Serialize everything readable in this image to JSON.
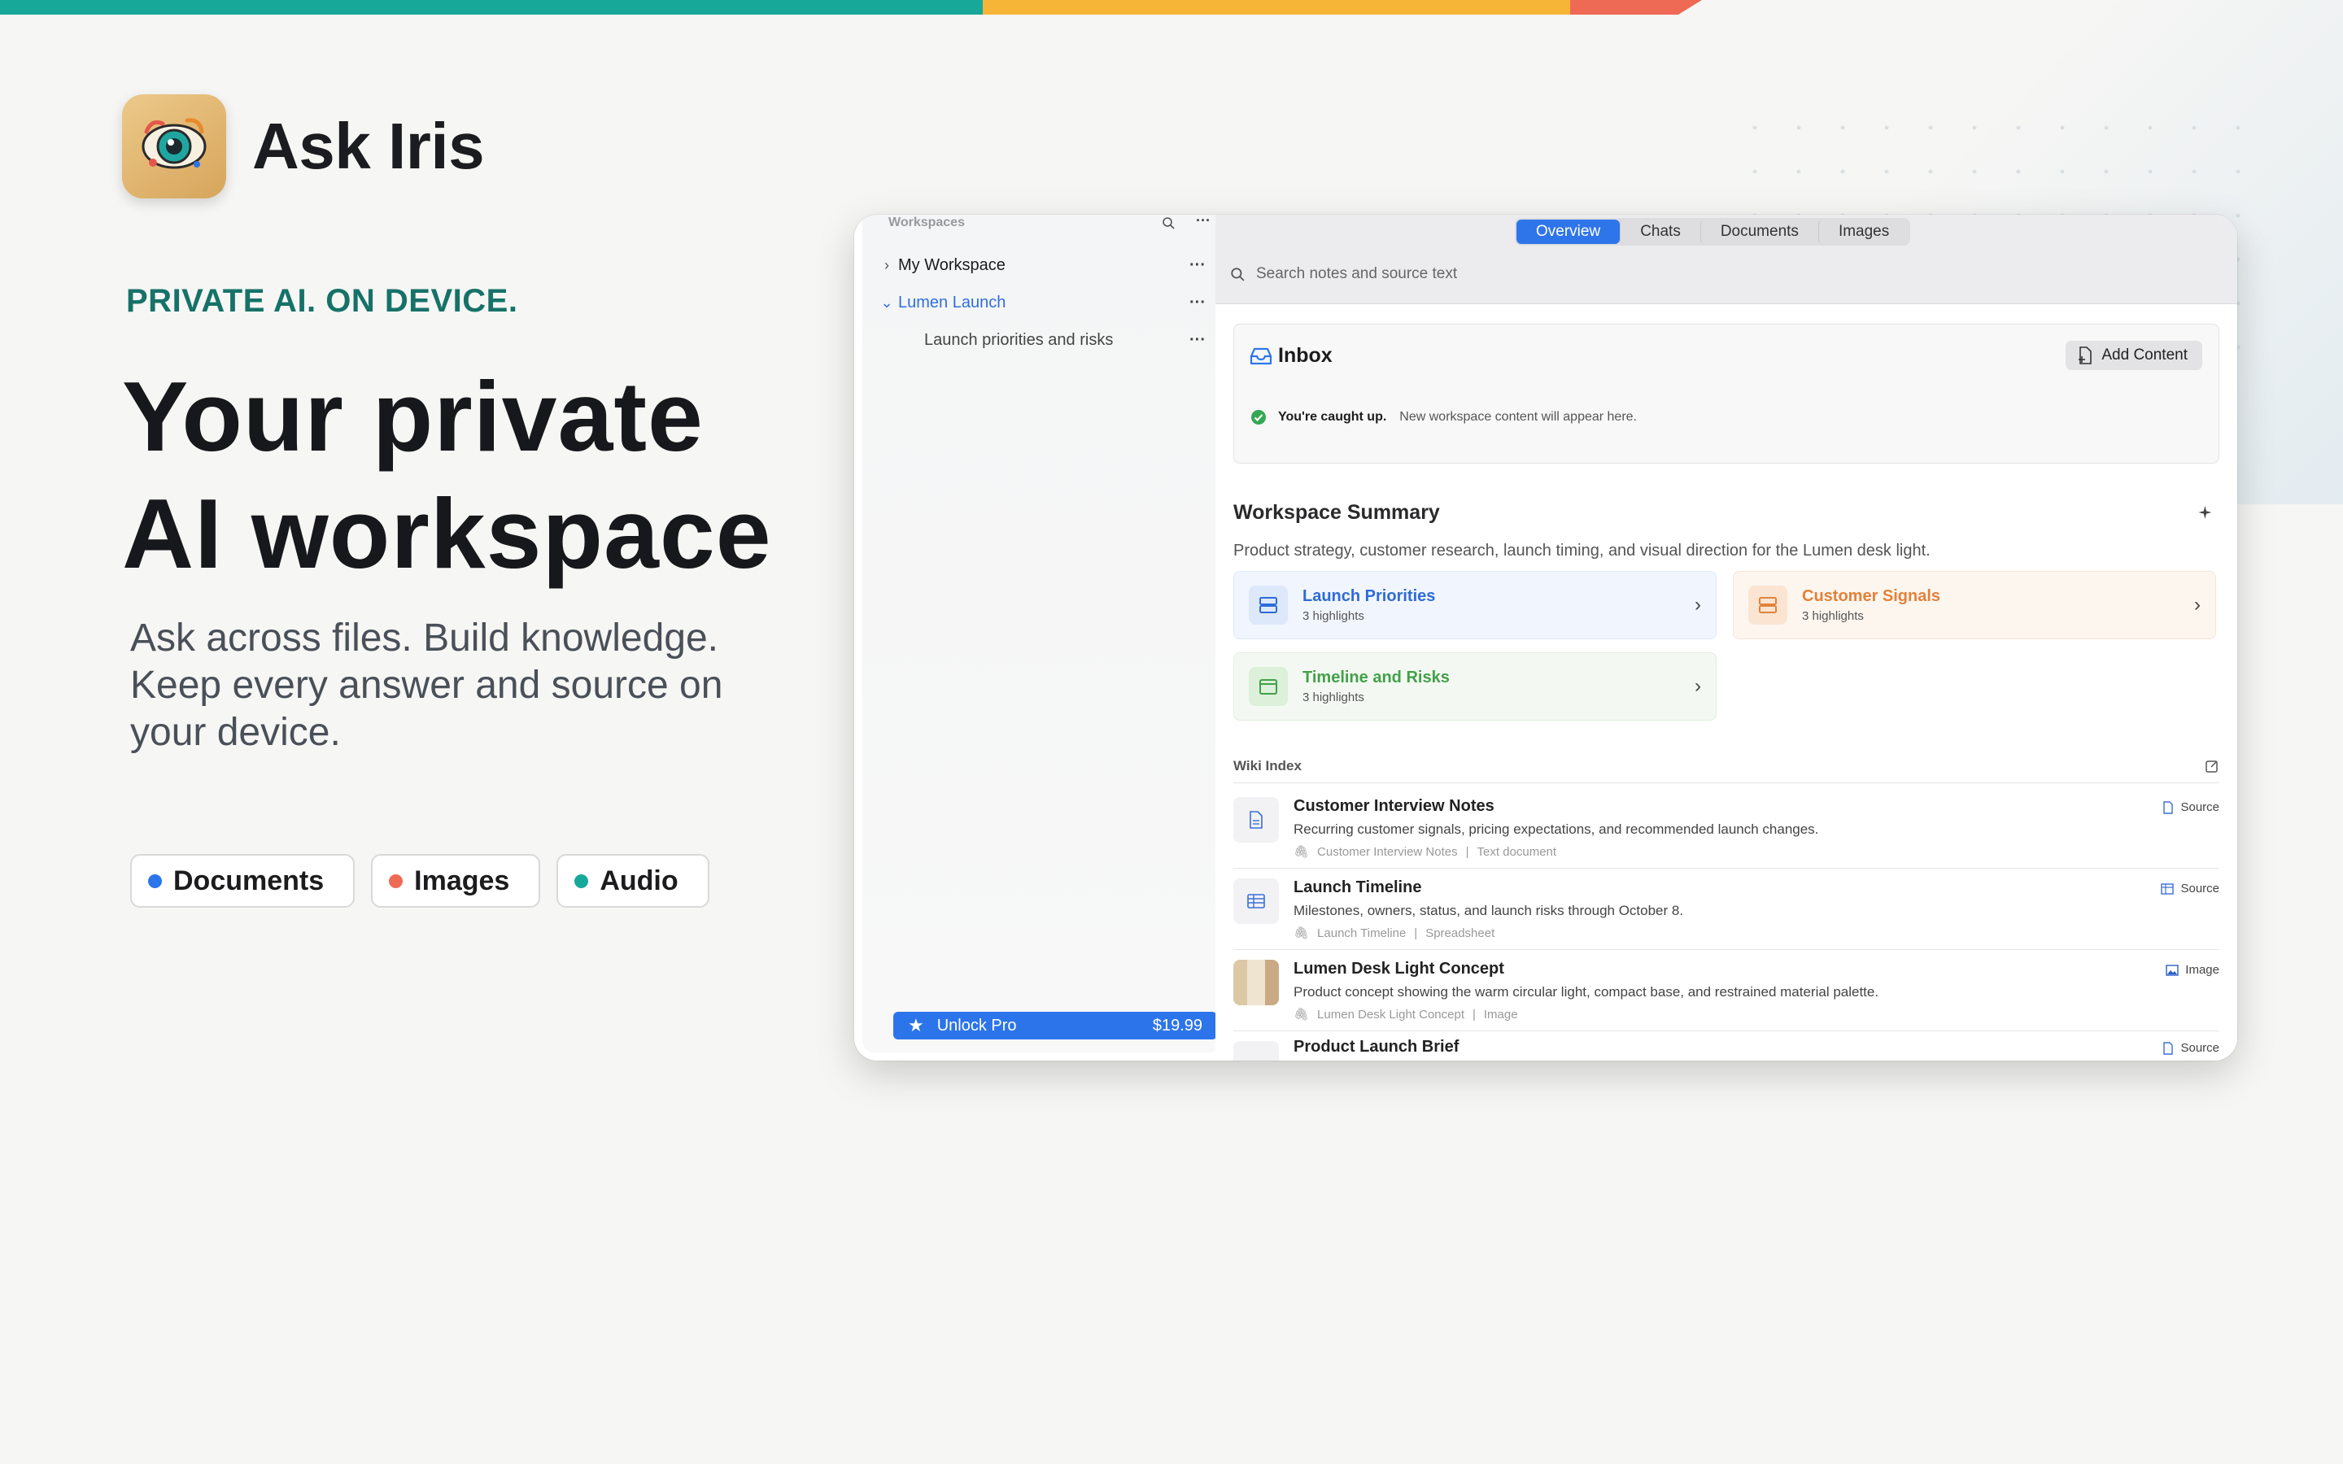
{
  "brand": {
    "name": "Ask Iris"
  },
  "hero": {
    "eyebrow": "PRIVATE AI. ON DEVICE.",
    "headline_line1": "Your private",
    "headline_line2": "AI workspace",
    "subcopy": "Ask across files. Build knowledge. Keep every answer and source on your device."
  },
  "chips": [
    {
      "label": "Documents",
      "color": "#2c74ea"
    },
    {
      "label": "Images",
      "color": "#ef6a55"
    },
    {
      "label": "Audio",
      "color": "#18a89a"
    }
  ],
  "sidebar": {
    "header": "Workspaces",
    "items": [
      {
        "label": "My Workspace"
      },
      {
        "label": "Lumen Launch"
      },
      {
        "label": "Launch priorities and risks"
      }
    ],
    "unlock": {
      "label": "Unlock Pro",
      "price": "$19.99"
    }
  },
  "toolbar": {
    "tabs": [
      "Overview",
      "Chats",
      "Documents",
      "Images"
    ],
    "search_placeholder": "Search notes and source text"
  },
  "inbox": {
    "title": "Inbox",
    "add_label": "Add Content",
    "status_bold": "You're caught up.",
    "status_msg": "New workspace content will appear here."
  },
  "summary": {
    "title": "Workspace Summary",
    "description": "Product strategy, customer research, launch timing, and visual direction for the Lumen desk light.",
    "cards": [
      {
        "title": "Launch Priorities",
        "sub": "3 highlights"
      },
      {
        "title": "Customer Signals",
        "sub": "3 highlights"
      },
      {
        "title": "Timeline and Risks",
        "sub": "3 highlights"
      }
    ]
  },
  "wiki": {
    "title": "Wiki Index",
    "rows": [
      {
        "title": "Customer Interview Notes",
        "desc": "Recurring customer signals, pricing expectations, and recommended launch changes.",
        "meta_name": "Customer Interview Notes",
        "meta_type": "Text document",
        "tag": "Source"
      },
      {
        "title": "Launch Timeline",
        "desc": "Milestones, owners, status, and launch risks through October 8.",
        "meta_name": "Launch Timeline",
        "meta_type": "Spreadsheet",
        "tag": "Source"
      },
      {
        "title": "Lumen Desk Light Concept",
        "desc": "Product concept showing the warm circular light, compact base, and restrained material palette.",
        "meta_name": "Lumen Desk Light Concept",
        "meta_type": "Image",
        "tag": "Image"
      },
      {
        "title": "Product Launch Brief",
        "tag": "Source"
      }
    ]
  },
  "colors": {
    "accent": "#2f75ea",
    "teal": "#18a89a",
    "amber": "#f7b538",
    "coral": "#ef6a55"
  }
}
